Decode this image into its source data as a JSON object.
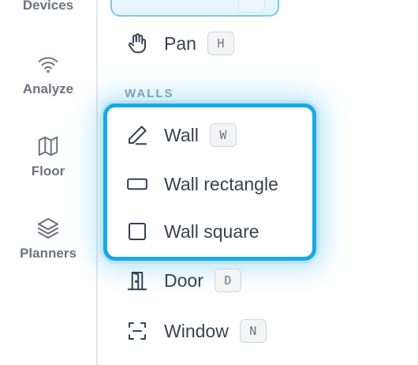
{
  "rail": {
    "items": [
      {
        "label": "Devices",
        "icon": "devices-icon"
      },
      {
        "label": "Analyze",
        "icon": "wifi-icon"
      },
      {
        "label": "Floor",
        "icon": "map-icon"
      },
      {
        "label": "Planners",
        "icon": "layers-icon"
      }
    ]
  },
  "menu": {
    "pan": {
      "label": "Pan",
      "shortcut": "H",
      "icon": "hand-icon"
    },
    "section_walls": "WALLS",
    "wall": {
      "label": "Wall",
      "shortcut": "W",
      "icon": "pencil-icon"
    },
    "wall_rectangle": {
      "label": "Wall rectangle",
      "icon": "rectangle-icon"
    },
    "wall_square": {
      "label": "Wall square",
      "icon": "square-icon"
    },
    "door": {
      "label": "Door",
      "shortcut": "D",
      "icon": "door-icon"
    },
    "window": {
      "label": "Window",
      "shortcut": "N",
      "icon": "window-icon"
    }
  },
  "colors": {
    "accent": "#1aa8e6",
    "selected_bg": "#e6f5fc"
  }
}
